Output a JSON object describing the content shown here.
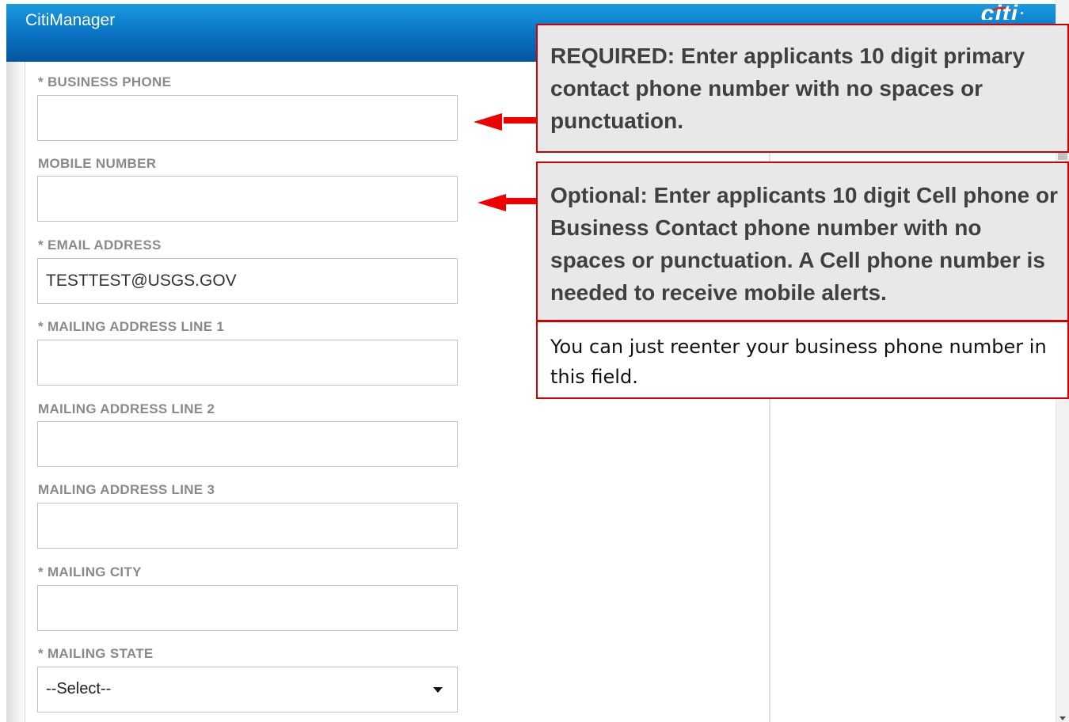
{
  "app": {
    "title": "CitiManager",
    "logo": "citi"
  },
  "form": {
    "business_phone": {
      "label": "* BUSINESS PHONE",
      "value": ""
    },
    "mobile_number": {
      "label": "MOBILE NUMBER",
      "value": ""
    },
    "email_address": {
      "label": "* EMAIL ADDRESS",
      "value": "TESTTEST@USGS.GOV"
    },
    "mailing_address_1": {
      "label": "* MAILING ADDRESS LINE 1",
      "value": ""
    },
    "mailing_address_2": {
      "label": "MAILING ADDRESS LINE 2",
      "value": ""
    },
    "mailing_address_3": {
      "label": "MAILING ADDRESS LINE 3",
      "value": ""
    },
    "mailing_city": {
      "label": "* MAILING CITY",
      "value": ""
    },
    "mailing_state": {
      "label": "* MAILING STATE",
      "selected": "--Select--"
    }
  },
  "callouts": {
    "required_phone": "REQUIRED: Enter applicants 10 digit primary contact phone number with no spaces or punctuation.",
    "optional_mobile": "Optional: Enter applicants 10 digit Cell phone or Business Contact phone number with no spaces or punctuation. A Cell phone number is needed to receive mobile alerts.",
    "reenter_tip": "You can just reenter your business phone number in this field."
  },
  "colors": {
    "header_blue": "#0a74c4",
    "callout_border": "#d00000",
    "arrow": "#ee0000",
    "label_gray": "#8a8a8a"
  }
}
